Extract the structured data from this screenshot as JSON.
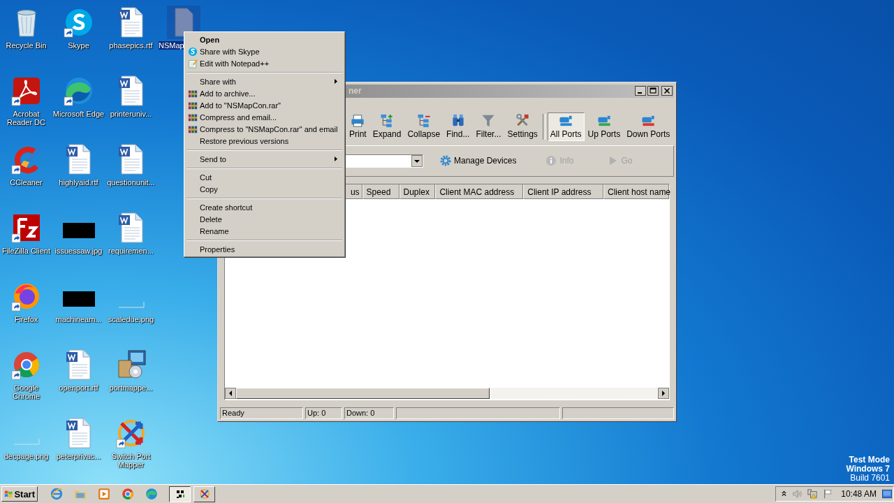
{
  "desktop_icons": [
    {
      "label": "Recycle Bin",
      "kind": "recycle",
      "shortcut": false,
      "selected": false
    },
    {
      "label": "Acrobat Reader DC",
      "kind": "pdf",
      "shortcut": true,
      "selected": false
    },
    {
      "label": "CCleaner",
      "kind": "ccleaner",
      "shortcut": true,
      "selected": false
    },
    {
      "label": "FileZilla Client",
      "kind": "filezilla",
      "shortcut": true,
      "selected": false
    },
    {
      "label": "Firefox",
      "kind": "firefox",
      "shortcut": true,
      "selected": false
    },
    {
      "label": "Google Chrome",
      "kind": "chrome",
      "shortcut": true,
      "selected": false
    },
    {
      "label": "decpage.png",
      "kind": "blank",
      "shortcut": false,
      "selected": false
    },
    {
      "label": "Skype",
      "kind": "skype",
      "shortcut": true,
      "selected": false
    },
    {
      "label": "Microsoft Edge",
      "kind": "edge",
      "shortcut": true,
      "selected": false
    },
    {
      "label": "highlyaid.rtf",
      "kind": "word",
      "shortcut": false,
      "selected": false
    },
    {
      "label": "issuessaw.jpg",
      "kind": "black",
      "shortcut": false,
      "selected": false
    },
    {
      "label": "machineam...",
      "kind": "black",
      "shortcut": false,
      "selected": false
    },
    {
      "label": "openport.rtf",
      "kind": "word",
      "shortcut": false,
      "selected": false
    },
    {
      "label": "peterprivac...",
      "kind": "word",
      "shortcut": false,
      "selected": false
    },
    {
      "label": "phasepics.rtf",
      "kind": "word",
      "shortcut": false,
      "selected": false
    },
    {
      "label": "printeruniv...",
      "kind": "word",
      "shortcut": false,
      "selected": false
    },
    {
      "label": "questionunit...",
      "kind": "word",
      "shortcut": false,
      "selected": false
    },
    {
      "label": "requiremen...",
      "kind": "word",
      "shortcut": false,
      "selected": false
    },
    {
      "label": "scaledue.png",
      "kind": "blank",
      "shortcut": false,
      "selected": false
    },
    {
      "label": "portmappe...",
      "kind": "installer",
      "shortcut": false,
      "selected": false
    },
    {
      "label": "Switch Port Mapper",
      "kind": "switch",
      "shortcut": true,
      "selected": false
    },
    {
      "label": "NSMap",
      "kind": "generic",
      "shortcut": false,
      "selected": true
    }
  ],
  "window": {
    "title": "ner",
    "toolbar": [
      {
        "label": "Print",
        "kind": "print",
        "selected": false
      },
      {
        "label": "Expand",
        "kind": "expand",
        "selected": false
      },
      {
        "label": "Collapse",
        "kind": "collapse",
        "selected": false
      },
      {
        "label": "Find...",
        "kind": "find",
        "selected": false
      },
      {
        "label": "Filter...",
        "kind": "filter",
        "selected": false
      },
      {
        "label": "Settings",
        "kind": "settings",
        "selected": false
      },
      {
        "kind": "separator"
      },
      {
        "label": "All Ports",
        "kind": "ports-all",
        "selected": true
      },
      {
        "label": "Up Ports",
        "kind": "ports-up",
        "selected": false
      },
      {
        "label": "Down Ports",
        "kind": "ports-down",
        "selected": false
      }
    ],
    "device_bar": {
      "manage": "Manage Devices",
      "info": {
        "label": "Info",
        "disabled": true
      },
      "go": {
        "label": "Go",
        "disabled": true
      }
    },
    "table": {
      "columns": [
        "us",
        "Speed",
        "Duplex",
        "Client MAC address",
        "Client IP address",
        "Client host name"
      ]
    },
    "status_bar": [
      "Ready",
      "Up: 0",
      "Down: 0"
    ]
  },
  "context_menu": [
    {
      "kind": "plain",
      "label": "Open",
      "bold": true,
      "submenu": false
    },
    {
      "kind": "skype",
      "label": "Share with Skype",
      "bold": false,
      "submenu": false
    },
    {
      "kind": "notepad",
      "label": "Edit with Notepad++",
      "bold": false,
      "submenu": false
    },
    {
      "kind": "separator"
    },
    {
      "kind": "plain",
      "label": "Share with",
      "bold": false,
      "submenu": true
    },
    {
      "kind": "archive",
      "label": "Add to archive...",
      "bold": false,
      "submenu": false
    },
    {
      "kind": "archive",
      "label": "Add to \"NSMapCon.rar\"",
      "bold": false,
      "submenu": false
    },
    {
      "kind": "archive",
      "label": "Compress and email...",
      "bold": false,
      "submenu": false
    },
    {
      "kind": "archive",
      "label": "Compress to \"NSMapCon.rar\" and email",
      "bold": false,
      "submenu": false
    },
    {
      "kind": "plain",
      "label": "Restore previous versions",
      "bold": false,
      "submenu": false
    },
    {
      "kind": "separator"
    },
    {
      "kind": "plain",
      "label": "Send to",
      "bold": false,
      "submenu": true
    },
    {
      "kind": "separator"
    },
    {
      "kind": "plain",
      "label": "Cut",
      "bold": false,
      "submenu": false
    },
    {
      "kind": "plain",
      "label": "Copy",
      "bold": false,
      "submenu": false
    },
    {
      "kind": "separator"
    },
    {
      "kind": "plain",
      "label": "Create shortcut",
      "bold": false,
      "submenu": false
    },
    {
      "kind": "plain",
      "label": "Delete",
      "bold": false,
      "submenu": false
    },
    {
      "kind": "plain",
      "label": "Rename",
      "bold": false,
      "submenu": false
    },
    {
      "kind": "separator"
    },
    {
      "kind": "plain",
      "label": "Properties",
      "bold": false,
      "submenu": false
    }
  ],
  "watermark_free_overlay": [
    "Test Mode",
    "Windows 7",
    "Build 7601"
  ],
  "taskbar": {
    "start": "Start",
    "quick_launch": [
      {
        "kind": "ie"
      },
      {
        "kind": "folder"
      },
      {
        "kind": "media"
      },
      {
        "kind": "chrome"
      },
      {
        "kind": "edge"
      }
    ],
    "tasks": [
      {
        "kind": "grid",
        "selected": true
      },
      {
        "kind": "switch",
        "selected": false
      }
    ],
    "clock": "10:48 AM"
  }
}
